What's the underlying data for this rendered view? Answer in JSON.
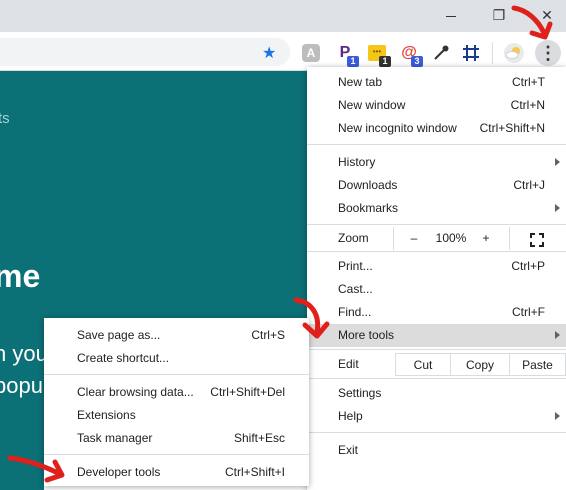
{
  "window": {
    "restore_glyph": "❐",
    "close_glyph": "✕"
  },
  "toolbar": {
    "star_glyph": "★",
    "kebab_glyph": "⋮"
  },
  "extensions": [
    {
      "name": "ext-a-icon",
      "glyph": "A",
      "badge": ""
    },
    {
      "name": "ext-p-icon",
      "glyph": "P",
      "badge": "1",
      "badge_color": "#3b5bdb"
    },
    {
      "name": "ext-note-icon",
      "glyph": "•••",
      "badge": "1",
      "badge_color": "#333333"
    },
    {
      "name": "ext-spiral-icon",
      "glyph": "@",
      "badge": "3",
      "badge_color": "#3b5bdb"
    },
    {
      "name": "ext-eyedropper-icon",
      "glyph": "",
      "badge": ""
    },
    {
      "name": "ext-grid-icon",
      "glyph": "#",
      "badge": ""
    },
    {
      "name": "ext-weather-icon",
      "glyph": "",
      "badge": ""
    }
  ],
  "page": {
    "text_ts": "ts",
    "text_me": "me",
    "text_you": "n you",
    "text_popu": "popu"
  },
  "main_menu": {
    "new_tab": {
      "label": "New tab",
      "shortcut": "Ctrl+T"
    },
    "new_window": {
      "label": "New window",
      "shortcut": "Ctrl+N"
    },
    "new_incognito": {
      "label": "New incognito window",
      "shortcut": "Ctrl+Shift+N"
    },
    "history": {
      "label": "History"
    },
    "downloads": {
      "label": "Downloads",
      "shortcut": "Ctrl+J"
    },
    "bookmarks": {
      "label": "Bookmarks"
    },
    "zoom": {
      "label": "Zoom",
      "minus": "–",
      "level": "100%",
      "plus": "+"
    },
    "print": {
      "label": "Print...",
      "shortcut": "Ctrl+P"
    },
    "cast": {
      "label": "Cast..."
    },
    "find": {
      "label": "Find...",
      "shortcut": "Ctrl+F"
    },
    "more_tools": {
      "label": "More tools"
    },
    "edit": {
      "label": "Edit",
      "cut": "Cut",
      "copy": "Copy",
      "paste": "Paste"
    },
    "settings": {
      "label": "Settings"
    },
    "help": {
      "label": "Help"
    },
    "exit": {
      "label": "Exit"
    }
  },
  "sub_menu": {
    "save_page": {
      "label": "Save page as...",
      "shortcut": "Ctrl+S"
    },
    "create_shortcut": {
      "label": "Create shortcut..."
    },
    "clear_browsing": {
      "label": "Clear browsing data...",
      "shortcut": "Ctrl+Shift+Del"
    },
    "extensions": {
      "label": "Extensions"
    },
    "task_manager": {
      "label": "Task manager",
      "shortcut": "Shift+Esc"
    },
    "developer_tools": {
      "label": "Developer tools",
      "shortcut": "Ctrl+Shift+I"
    }
  },
  "colors": {
    "accent": "#0c7077",
    "annotation_arrow": "#e0201b",
    "highlight": "#dcdcdc"
  }
}
